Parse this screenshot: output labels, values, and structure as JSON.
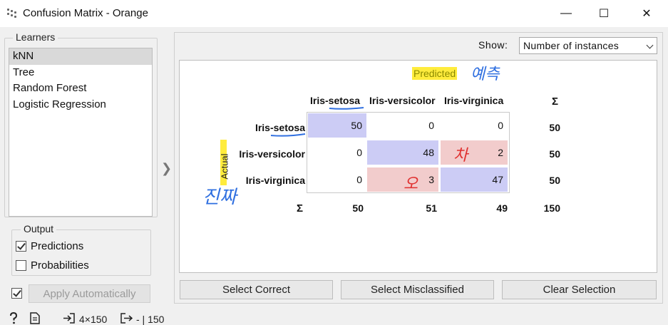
{
  "window": {
    "title": "Confusion Matrix - Orange",
    "minimize": "—",
    "maximize": "☐",
    "close": "✕"
  },
  "learners": {
    "legend": "Learners",
    "items": [
      "kNN",
      "Tree",
      "Random Forest",
      "Logistic Regression"
    ],
    "selected": 0
  },
  "output": {
    "legend": "Output",
    "predictions_label": "Predictions",
    "predictions_checked": true,
    "probabilities_label": "Probabilities",
    "probabilities_checked": false
  },
  "apply": {
    "label": "Apply Automatically",
    "checked": true
  },
  "status": {
    "input_summary": "4×150",
    "output_summary": "- | 150"
  },
  "show": {
    "label": "Show:",
    "value": "Number of instances"
  },
  "matrix": {
    "predicted_label": "Predicted",
    "actual_label": "Actual",
    "sigma": "Σ",
    "columns": [
      "Iris-setosa",
      "Iris-versicolor",
      "Iris-virginica"
    ],
    "rows": [
      {
        "label": "Iris-setosa",
        "values": [
          "50",
          "0",
          "0"
        ],
        "total": "50"
      },
      {
        "label": "Iris-versicolor",
        "values": [
          "0",
          "48",
          "2"
        ],
        "total": "50"
      },
      {
        "label": "Iris-virginica",
        "values": [
          "0",
          "3",
          "47"
        ],
        "total": "50"
      }
    ],
    "column_totals": [
      "50",
      "51",
      "49"
    ],
    "grand_total": "150"
  },
  "buttons": {
    "select_correct": "Select Correct",
    "select_misclassified": "Select Misclassified",
    "clear_selection": "Clear Selection"
  },
  "annotations": {
    "predicted_note": "예측",
    "actual_note": "진짜",
    "error_note_1": "차",
    "error_note_2": "오",
    "highlight_color": "#ffec3d",
    "pen_blue": "#2f6fe0",
    "pen_red": "#e0302f"
  }
}
